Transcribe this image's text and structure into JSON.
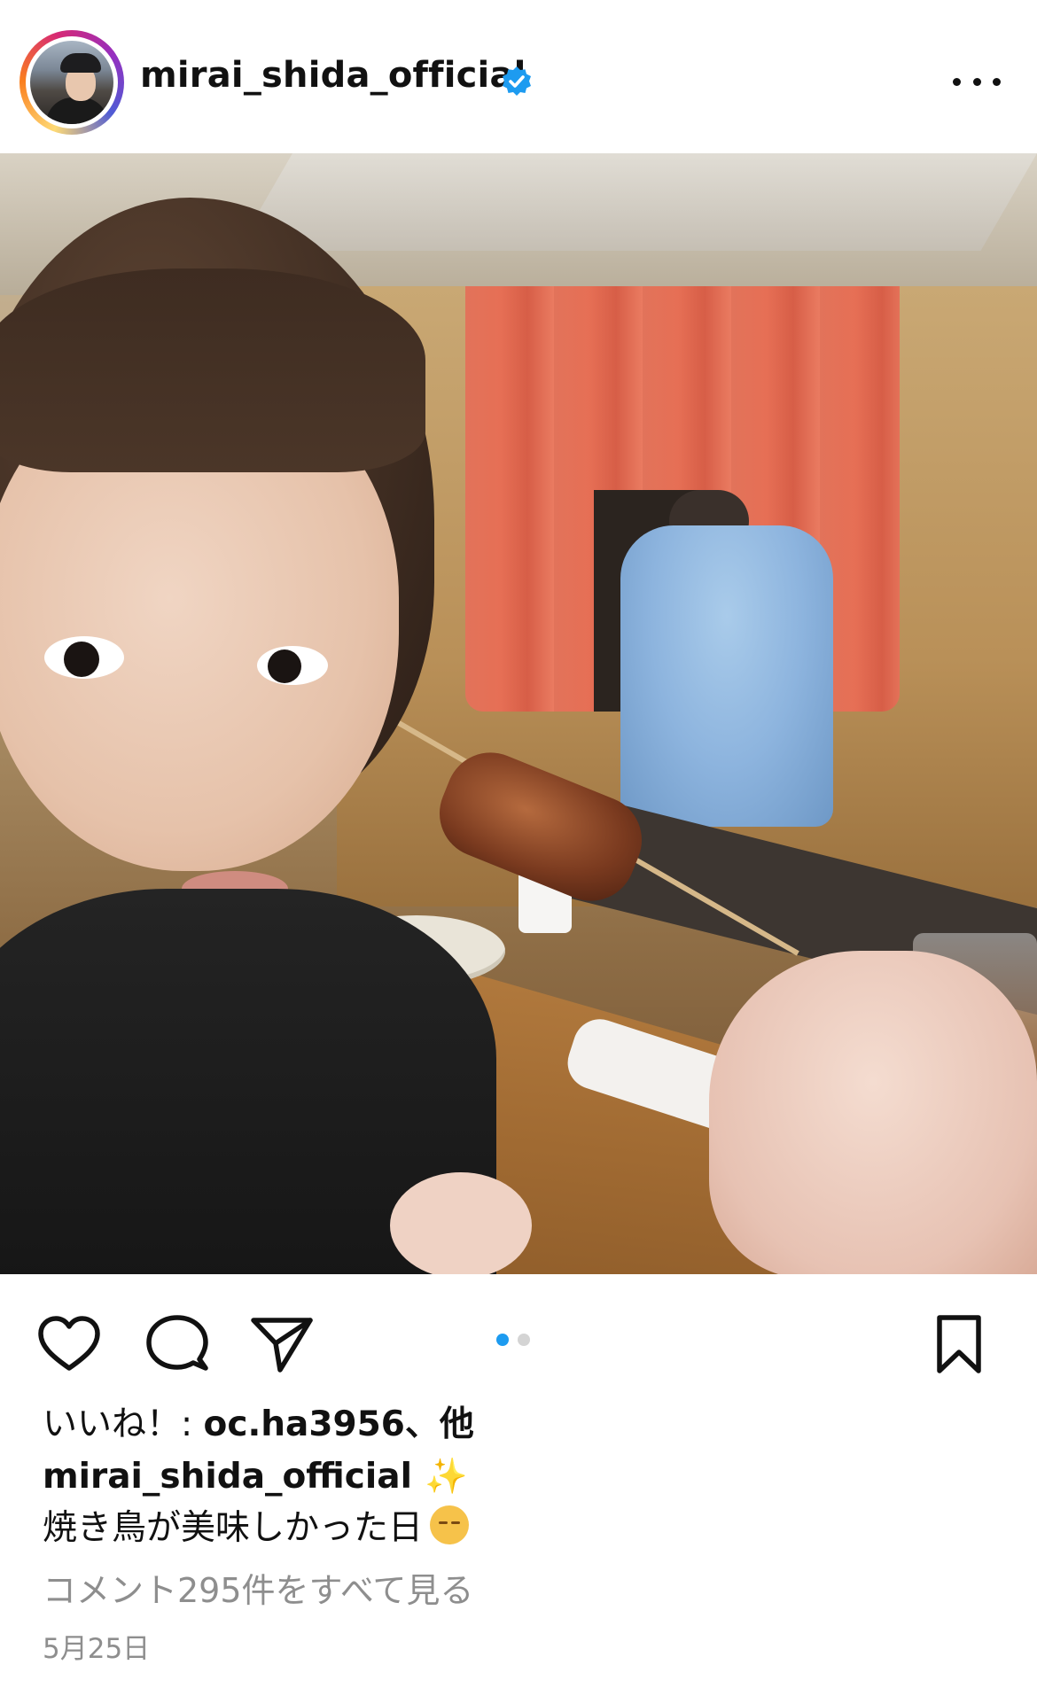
{
  "header": {
    "username": "mirai_shida_official",
    "verified": true,
    "more_icon": "more-horizontal-icon"
  },
  "post": {
    "photo_alt": "",
    "carousel": {
      "count": 2,
      "active": 1
    }
  },
  "actions": {
    "like_icon": "heart-icon",
    "comment_icon": "comment-icon",
    "share_icon": "send-icon",
    "save_icon": "bookmark-icon"
  },
  "likes": {
    "prefix": "いいね！: ",
    "text": "oc.ha3956、他"
  },
  "caption": {
    "username": "mirai_shida_official",
    "sparkle": "✨",
    "text": "焼き鳥が美味しかった日"
  },
  "comments_link": "コメント295件をすべて見る",
  "date": "5月25日",
  "colors": {
    "accent": "#1d9bf0",
    "secondary_text": "#8e8e8e"
  }
}
